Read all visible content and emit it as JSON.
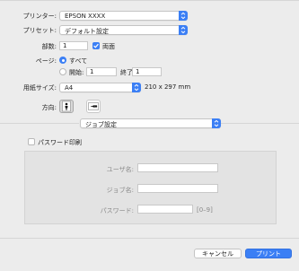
{
  "printer": {
    "label": "プリンター:",
    "value": "EPSON XXXX"
  },
  "preset": {
    "label": "プリセット:",
    "value": "デフォルト設定"
  },
  "copies": {
    "label": "部数:",
    "value": "1",
    "duplex_label": "両面",
    "duplex_checked": true
  },
  "pages": {
    "label": "ページ:",
    "all_label": "すべて",
    "from_label": "開始:",
    "from_value": "1",
    "to_label": "終了:",
    "to_value": "1",
    "selected": "all"
  },
  "paper": {
    "label": "用紙サイズ:",
    "value": "A4",
    "dimensions": "210 x 297 mm"
  },
  "orientation": {
    "label": "方向:",
    "selected": "portrait"
  },
  "section_popup": {
    "value": "ジョブ設定"
  },
  "password_print": {
    "label": "パスワード印刷",
    "checked": false,
    "user_name_label": "ユーザ名:",
    "user_name_value": "",
    "job_name_label": "ジョブ名:",
    "job_name_value": "",
    "password_label": "パスワード:",
    "password_value": "",
    "password_hint": "[0–9]"
  },
  "footer": {
    "cancel_label": "キャンセル",
    "print_label": "プリント"
  },
  "colors": {
    "accent": "#3b7ff5",
    "background": "#ececec",
    "panel": "#e3e3e3"
  }
}
